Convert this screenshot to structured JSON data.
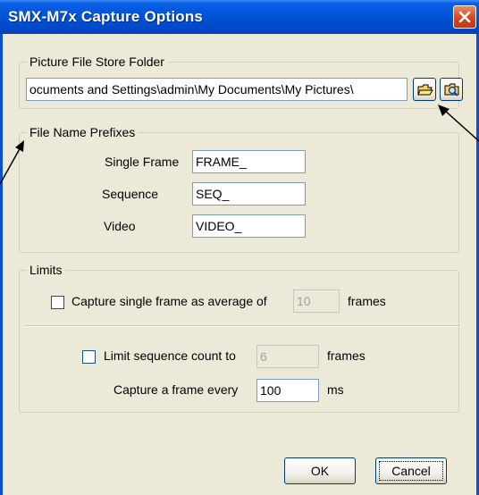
{
  "window": {
    "title": "SMX-M7x Capture Options"
  },
  "store_folder": {
    "legend": "Picture File Store Folder",
    "path": "ocuments and Settings\\admin\\My Documents\\My Pictures\\",
    "browse_icon": "folder-open-icon",
    "explore_icon": "explore-folder-icon"
  },
  "prefixes": {
    "legend": "File Name Prefixes",
    "single_frame_label": "Single Frame",
    "single_frame_value": "FRAME_",
    "sequence_label": "Sequence",
    "sequence_value": "SEQ_",
    "video_label": "Video",
    "video_value": "VIDEO_"
  },
  "limits": {
    "legend": "Limits",
    "average_label": "Capture single frame as average of",
    "average_value": "10",
    "average_unit": "frames",
    "average_checked": false,
    "sequence_label": "Limit sequence count to",
    "sequence_value": "6",
    "sequence_unit": "frames",
    "sequence_checked": false,
    "every_label": "Capture a frame every",
    "every_value": "100",
    "every_unit": "ms"
  },
  "buttons": {
    "ok": "OK",
    "cancel": "Cancel"
  }
}
